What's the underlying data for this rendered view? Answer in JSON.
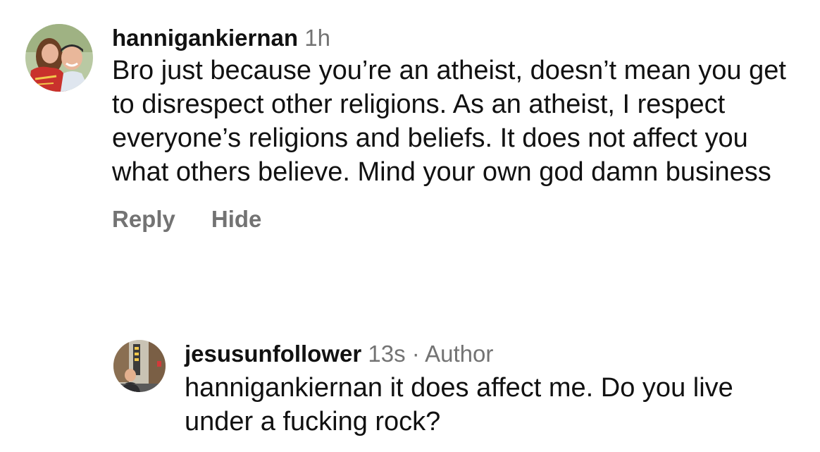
{
  "comments": [
    {
      "username": "hannigankiernan",
      "time": "1h",
      "text": "Bro just because you’re an atheist, doesn’t mean you get to disrespect other religions. As an atheist, I respect everyone’s religions and beliefs. It does not affect you what others believe. Mind your own god damn business",
      "actions": {
        "reply": "Reply",
        "hide": "Hide"
      },
      "avatar": "profile-photo"
    },
    {
      "username": "jesusunfollower",
      "time": "13s",
      "separator": "·",
      "author_badge": "Author",
      "text": "hannigankiernan it does affect me. Do you live under a fucking rock?",
      "avatar": "profile-photo"
    }
  ],
  "colors": {
    "text": "#111111",
    "secondary": "#737373",
    "background": "#ffffff"
  }
}
